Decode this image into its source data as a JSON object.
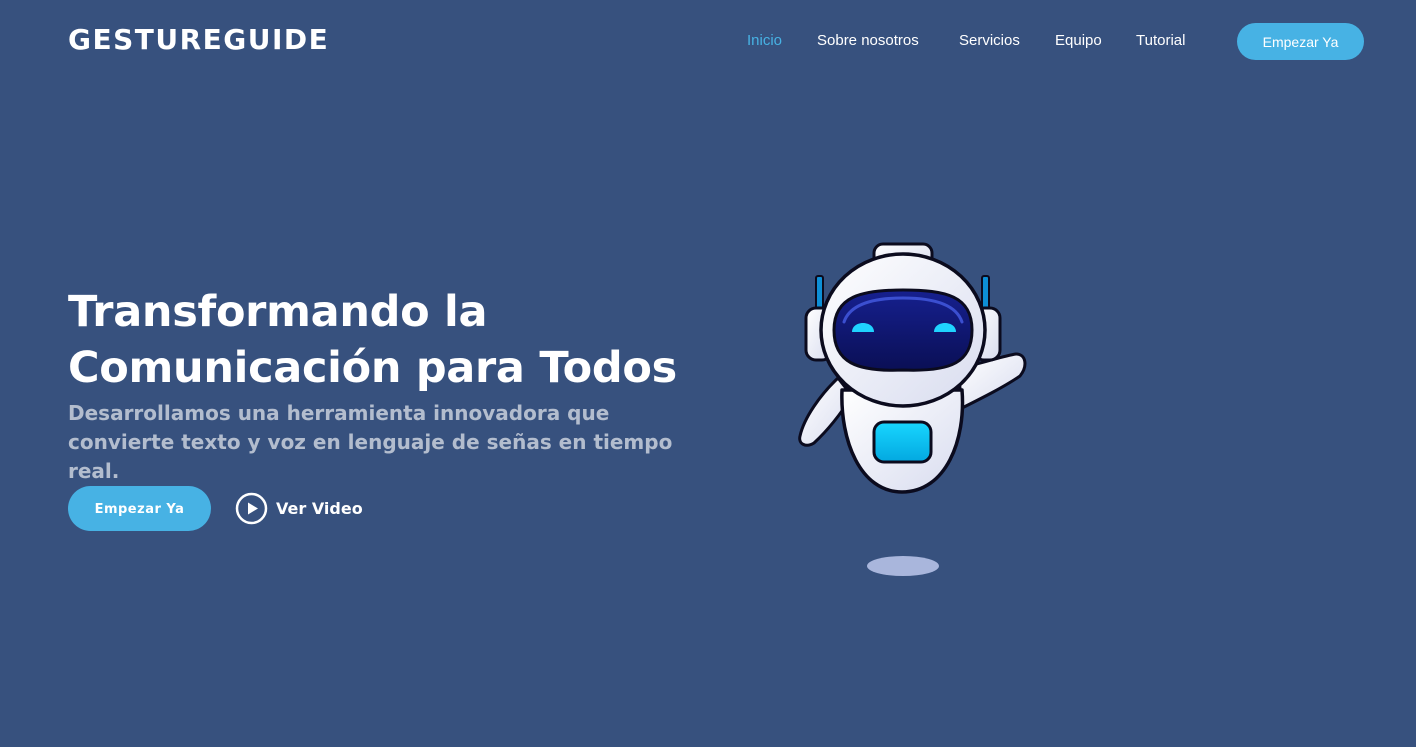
{
  "brand": {
    "logo": "GESTUREGUIDE"
  },
  "nav": {
    "items": [
      {
        "label": "Inicio",
        "active": true
      },
      {
        "label": "Sobre nosotros",
        "active": false
      },
      {
        "label": "Servicios",
        "active": false
      },
      {
        "label": "Equipo",
        "active": false
      },
      {
        "label": "Tutorial",
        "active": false
      }
    ],
    "cta_label": "Empezar Ya"
  },
  "hero": {
    "title": "Transformando la Comunicación para Todos",
    "subtitle": "Desarrollamos una herramienta innovadora que convierte texto y voz en lenguaje de señas en tiempo real.",
    "cta_label": "Empezar Ya",
    "video_label": "Ver Video",
    "illustration": "robot-mascot"
  },
  "colors": {
    "background": "#37517e",
    "accent": "#47b2e4",
    "text": "#ffffff"
  }
}
